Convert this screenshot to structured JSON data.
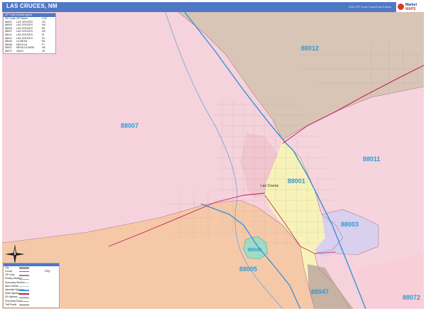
{
  "header": {
    "title": "LAS CRUCES, NM",
    "edition": "2022 ZIP Code Color/Cast Edition",
    "logo_line1": "Market",
    "logo_line2": "MAPS"
  },
  "legend": {
    "heading": "ZIP Code Areas/Legend",
    "columns": [
      "ZIP Code",
      "ZIP Name",
      "LOC"
    ],
    "rows": [
      [
        "88001",
        "LAS CRUCES",
        "G4"
      ],
      [
        "88003",
        "LAS CRUCES",
        "H6"
      ],
      [
        "88005",
        "LAS CRUCES",
        "E6"
      ],
      [
        "88007",
        "LAS CRUCES",
        "D5"
      ],
      [
        "88011",
        "LAS CRUCES",
        "I5"
      ],
      [
        "88012",
        "LAS CRUCES",
        "F2"
      ],
      [
        "88044",
        "LA MESA",
        "E6"
      ],
      [
        "88046",
        "MESILLA",
        "F7"
      ],
      [
        "88047",
        "MESILLA PARK",
        "H6"
      ],
      [
        "88072",
        "VADO",
        "J8"
      ]
    ]
  },
  "key": {
    "items": [
      "City",
      "County",
      "ZIP Code",
      "Primary Weather",
      "Secondary Weather",
      "Minor Streets",
      "Interstate Highway",
      "State Highway",
      "US Highway",
      "Secondary Road",
      "Trail Roads"
    ],
    "city_label": "City"
  },
  "zips": {
    "z88012": "88012",
    "z88007": "88007",
    "z88011": "88011",
    "z88001": "88001",
    "z88003": "88003",
    "z88046": "88046",
    "z88005": "88005",
    "z88047": "88047",
    "z88072": "88072"
  },
  "city_label": "Las Cruces",
  "colors": {
    "header_bar": "#4f78c4",
    "zip_label": "#2e9ad6",
    "zone_88007": "#f6d3dc",
    "zone_88012": "#d8c5b6",
    "zone_88011": "#f6d4dd",
    "zone_88001": "#f7f3b8",
    "zone_88003": "#d8d0ee",
    "zone_88005": "#f5c9a8",
    "zone_88047": "#c7b3a4",
    "zone_88072": "#f8cfd9",
    "zone_88046": "#9fdcc6",
    "interstate": "#3a8fd8",
    "highway": "#c2185b"
  }
}
